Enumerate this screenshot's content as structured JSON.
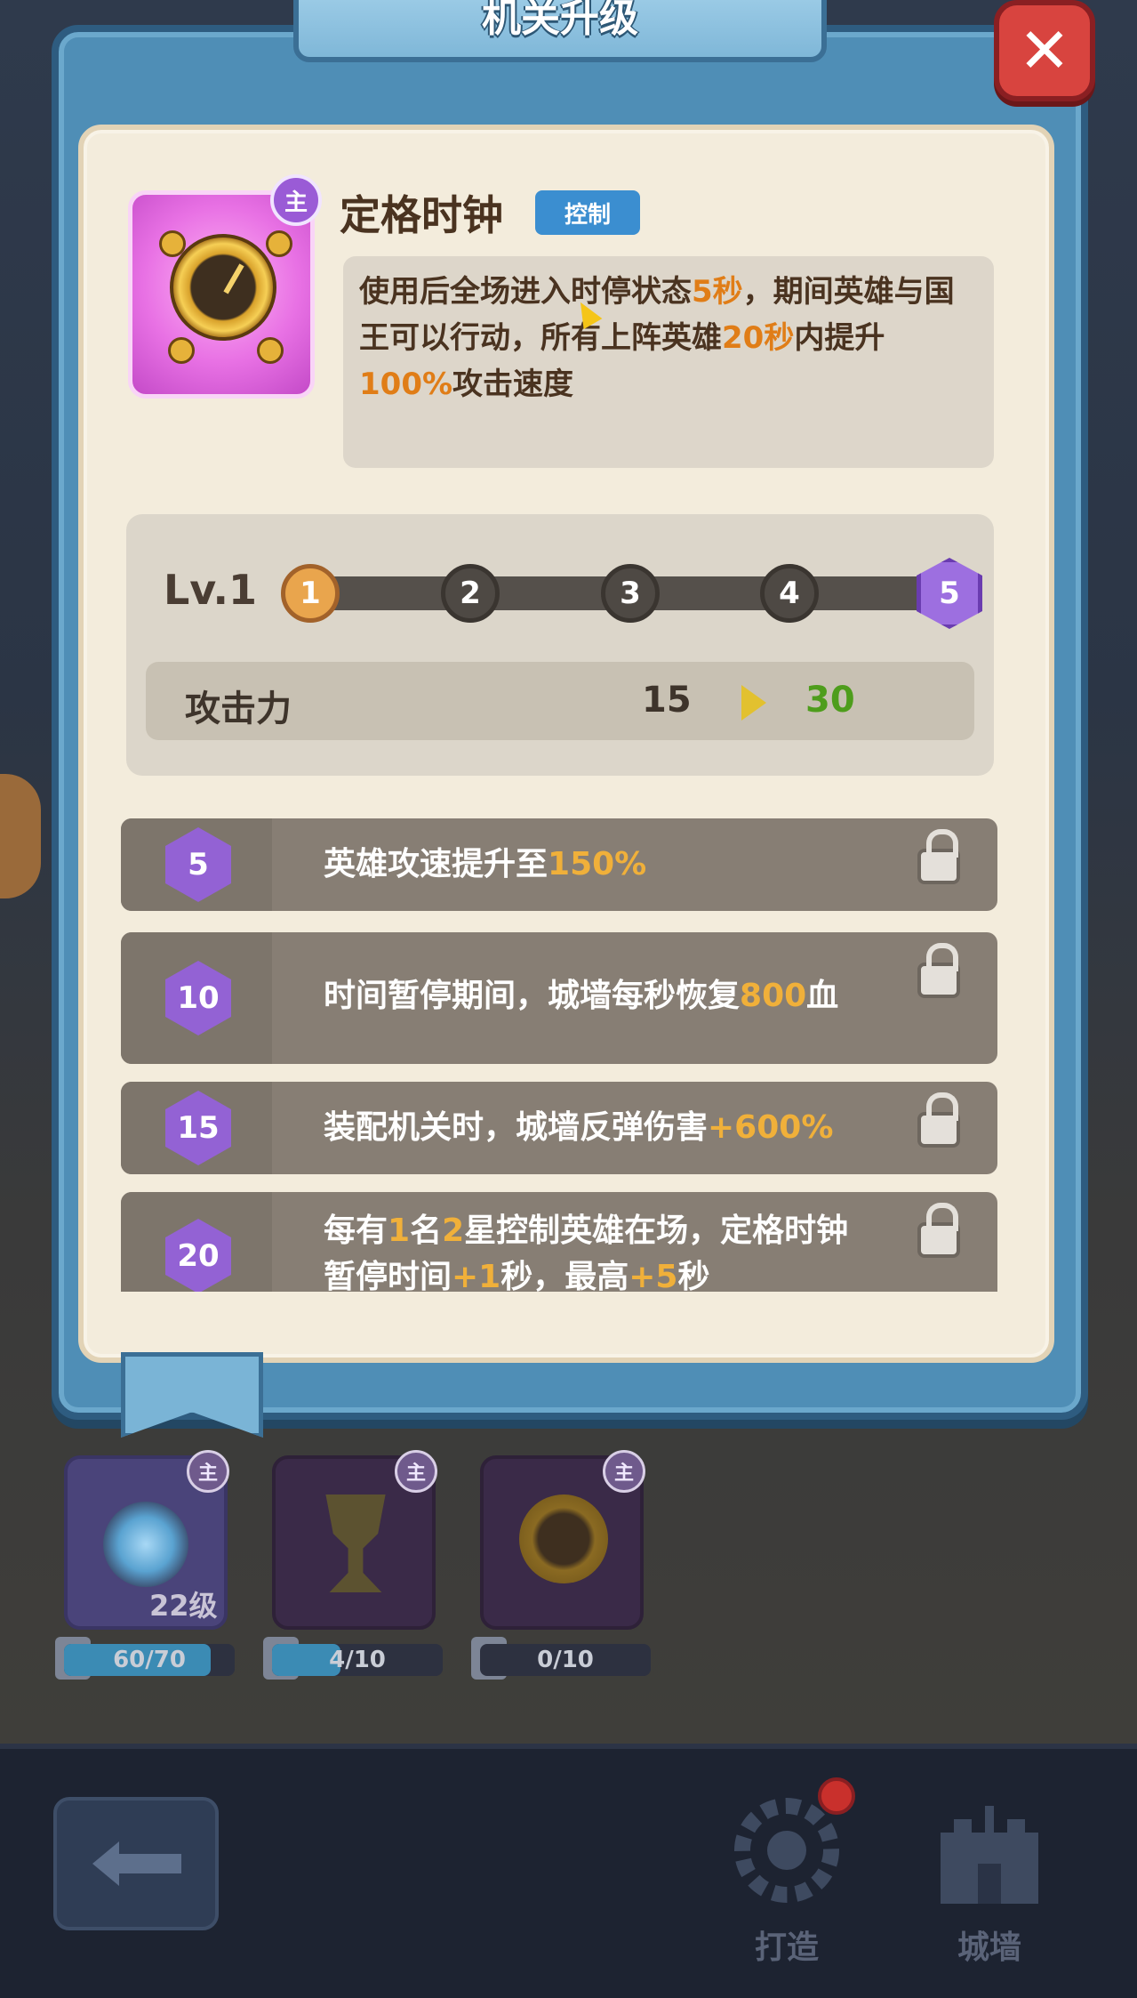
{
  "modal": {
    "title": "机关升级",
    "close_icon": "close-icon"
  },
  "item": {
    "icon": "clock-icon",
    "main_badge": "主",
    "name": "定格时钟",
    "type_tag": "控制",
    "description_parts": [
      "使用后全场进入时停状态",
      "5秒",
      "，期间英雄与国王可以行动，所有上阵英雄",
      "20秒",
      "内提升",
      "100%",
      "攻击速度"
    ]
  },
  "level": {
    "label": "Lv.1",
    "nodes": [
      "1",
      "2",
      "3",
      "4",
      "5"
    ],
    "current_node": 1,
    "stat": {
      "name": "攻击力",
      "current": "15",
      "next": "30"
    }
  },
  "perks": [
    {
      "level": "5",
      "text": "英雄攻速提升至",
      "value": "150%",
      "suffix": ""
    },
    {
      "level": "10",
      "text": "时间暂停期间，城墙每秒恢复",
      "value": "800",
      "suffix": "血"
    },
    {
      "level": "15",
      "text": "装配机关时，城墙反弹伤害",
      "value": "+600%",
      "suffix": ""
    },
    {
      "level": "20",
      "line1_a": "每有",
      "line1_b": "1",
      "line1_c": "名",
      "line1_d": "2",
      "line1_e": "星控制英雄在场，定格时钟",
      "line2_a": "暂停时间",
      "line2_b": "+1",
      "line2_c": "秒，最高",
      "line2_d": "+5",
      "line2_e": "秒"
    }
  ],
  "slots": [
    {
      "badge": "主",
      "level_text": "22级",
      "progress": "60/70",
      "fill": 0.857
    },
    {
      "badge": "主",
      "progress": "4/10",
      "fill": 0.4
    },
    {
      "badge": "主",
      "progress": "0/10",
      "fill": 0.0
    }
  ],
  "nav": {
    "back_icon": "back-arrow-icon",
    "forge_label": "打造",
    "wall_label": "城墙"
  },
  "colors": {
    "highlight": "#e07d17",
    "perk_value": "#f0b03a",
    "next_value": "#4e9d1c",
    "purple": "#9362d4"
  }
}
